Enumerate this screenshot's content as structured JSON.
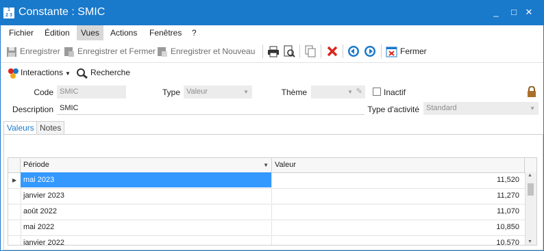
{
  "window": {
    "title": "Constante : SMIC",
    "app_icon": "numbers-icon",
    "buttons": {
      "minimize": "_",
      "maximize": "□",
      "close": "✕"
    }
  },
  "menu": [
    "Fichier",
    "Édition",
    "Vues",
    "Actions",
    "Fenêtres",
    "?"
  ],
  "toolbar": {
    "save": "Enregistrer",
    "save_close": "Enregistrer et Fermer",
    "save_new": "Enregistrer et Nouveau",
    "close": "Fermer"
  },
  "toolbar2": {
    "interactions": "Interactions",
    "search": "Recherche"
  },
  "form": {
    "code_label": "Code",
    "code_value": "SMIC",
    "type_label": "Type",
    "type_value": "Valeur",
    "theme_label": "Thème",
    "theme_value": "",
    "inactive_label": "Inactif",
    "description_label": "Description",
    "description_value": "SMIC",
    "activity_label": "Type d'activité",
    "activity_value": "Standard"
  },
  "tabs": [
    "Valeurs",
    "Notes"
  ],
  "grid": {
    "columns": [
      "Période",
      "Valeur"
    ],
    "rows": [
      {
        "period": "mai 2023",
        "value": "11,520"
      },
      {
        "period": "janvier 2023",
        "value": "11,270"
      },
      {
        "period": "août 2022",
        "value": "11,070"
      },
      {
        "period": "mai 2022",
        "value": "10,850"
      },
      {
        "period": "janvier 2022",
        "value": "10,570"
      }
    ]
  },
  "colors": {
    "accent": "#1979ca",
    "selection": "#3399ff",
    "delete": "#d9261c"
  }
}
